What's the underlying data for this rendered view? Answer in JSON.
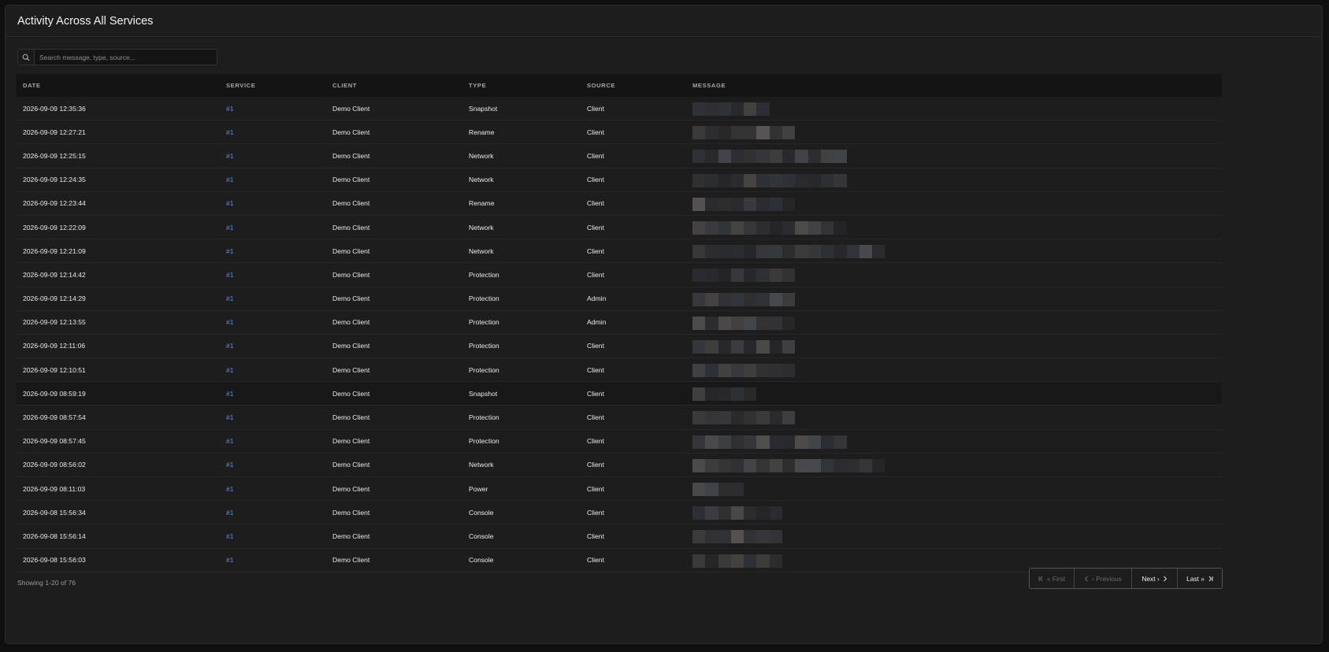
{
  "panel": {
    "title": "Activity Across All Services"
  },
  "search": {
    "placeholder": "Search message, type, source..."
  },
  "table": {
    "columns": [
      "DATE",
      "SERVICE",
      "CLIENT",
      "TYPE",
      "SOURCE",
      "MESSAGE"
    ],
    "rows": [
      {
        "date": "2026-09-09 12:35:36",
        "service": "#1",
        "client": "Demo Client",
        "type": "Snapshot",
        "source": "Client"
      },
      {
        "date": "2026-09-09 12:27:21",
        "service": "#1",
        "client": "Demo Client",
        "type": "Rename",
        "source": "Client"
      },
      {
        "date": "2026-09-09 12:25:15",
        "service": "#1",
        "client": "Demo Client",
        "type": "Network",
        "source": "Client"
      },
      {
        "date": "2026-09-09 12:24:35",
        "service": "#1",
        "client": "Demo Client",
        "type": "Network",
        "source": "Client"
      },
      {
        "date": "2026-09-09 12:23:44",
        "service": "#1",
        "client": "Demo Client",
        "type": "Rename",
        "source": "Client"
      },
      {
        "date": "2026-09-09 12:22:09",
        "service": "#1",
        "client": "Demo Client",
        "type": "Network",
        "source": "Client"
      },
      {
        "date": "2026-09-09 12:21:09",
        "service": "#1",
        "client": "Demo Client",
        "type": "Network",
        "source": "Client"
      },
      {
        "date": "2026-09-09 12:14:42",
        "service": "#1",
        "client": "Demo Client",
        "type": "Protection",
        "source": "Client"
      },
      {
        "date": "2026-09-09 12:14:29",
        "service": "#1",
        "client": "Demo Client",
        "type": "Protection",
        "source": "Admin"
      },
      {
        "date": "2026-09-09 12:13:55",
        "service": "#1",
        "client": "Demo Client",
        "type": "Protection",
        "source": "Admin"
      },
      {
        "date": "2026-09-09 12:11:06",
        "service": "#1",
        "client": "Demo Client",
        "type": "Protection",
        "source": "Client"
      },
      {
        "date": "2026-09-09 12:10:51",
        "service": "#1",
        "client": "Demo Client",
        "type": "Protection",
        "source": "Client"
      },
      {
        "date": "2026-09-09 08:59:19",
        "service": "#1",
        "client": "Demo Client",
        "type": "Snapshot",
        "source": "Client"
      },
      {
        "date": "2026-09-09 08:57:54",
        "service": "#1",
        "client": "Demo Client",
        "type": "Protection",
        "source": "Client"
      },
      {
        "date": "2026-09-09 08:57:45",
        "service": "#1",
        "client": "Demo Client",
        "type": "Protection",
        "source": "Client"
      },
      {
        "date": "2026-09-09 08:56:02",
        "service": "#1",
        "client": "Demo Client",
        "type": "Network",
        "source": "Client"
      },
      {
        "date": "2026-09-09 08:11:03",
        "service": "#1",
        "client": "Demo Client",
        "type": "Power",
        "source": "Client"
      },
      {
        "date": "2026-09-08 15:56:34",
        "service": "#1",
        "client": "Demo Client",
        "type": "Console",
        "source": "Client"
      },
      {
        "date": "2026-09-08 15:56:14",
        "service": "#1",
        "client": "Demo Client",
        "type": "Console",
        "source": "Client"
      },
      {
        "date": "2026-09-08 15:56:03",
        "service": "#1",
        "client": "Demo Client",
        "type": "Console",
        "source": "Client"
      }
    ],
    "highlighted_row": 12
  },
  "footer": {
    "showing": "Showing 1-20 of 76"
  },
  "pagination": {
    "first": "« First",
    "previous": "‹ Previous",
    "next": "Next ›",
    "last": "Last »"
  },
  "colors": {
    "background": "#0f0f0f",
    "panel": "#1d1d1d",
    "link": "#5f8fd6"
  }
}
